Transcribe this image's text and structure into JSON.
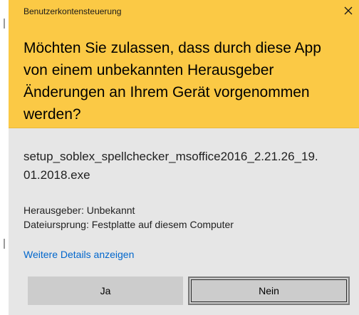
{
  "dialog": {
    "title": "Benutzerkontensteuerung",
    "question": "Möchten Sie zulassen, dass durch diese App von einem unbekannten Herausgeber Änderungen an Ihrem Gerät vorgenommen werden?",
    "close_icon": "close-icon",
    "filename": "setup_soblex_spellchecker_msoffice2016_2.21.26_19.01.2018.exe",
    "publisher": "Herausgeber: Unbekannt",
    "origin": "Dateiursprung: Festplatte auf diesem Computer",
    "details_link": "Weitere Details anzeigen",
    "yes_label": "Ja",
    "no_label": "Nein"
  },
  "colors": {
    "header": "#fbc945",
    "body": "#e6e6e6",
    "link": "#0066cc",
    "button": "#cccccc"
  }
}
